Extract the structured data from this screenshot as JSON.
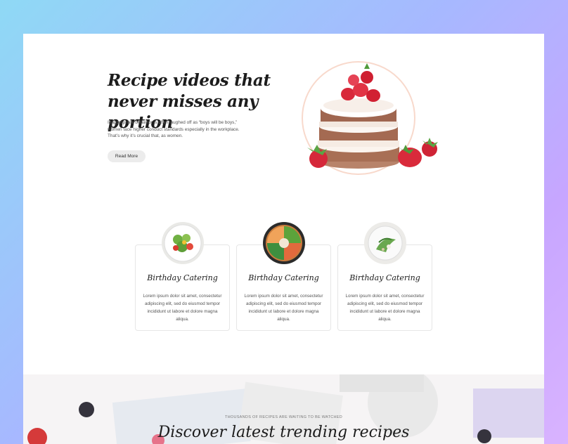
{
  "hero": {
    "title": "Recipe videos that never misses any portion",
    "description": "Inappropriate behavior is often laughed off as “boys will be boys,” women face higher conduct standards especially in the workplace. That’s why it’s crucial that, as women.",
    "button_label": "Read More",
    "image_icon": "strawberry-cake-image"
  },
  "services": [
    {
      "title": "Birthday Catering",
      "text": "Lorem ipsum dolor sit amet, consectetur adipiscing elit, sed do eiusmod tempor incididunt ut labore et dolore magna aliqua.",
      "image_icon": "salad-plate-image"
    },
    {
      "title": "Birthday Catering",
      "text": "Lorem ipsum dolor sit amet, consectetur adipiscing elit, sed do eiusmod tempor incididunt ut labore et dolore magna aliqua.",
      "image_icon": "poke-bowl-image"
    },
    {
      "title": "Birthday Catering",
      "text": "Lorem ipsum dolor sit amet, consectetur adipiscing elit, sed do eiusmod tempor incididunt ut labore et dolore magna aliqua.",
      "image_icon": "greens-plate-image"
    }
  ],
  "banner": {
    "kicker": "THOUSANDS OF RECIPES ARE WAITING TO BE WATCHED",
    "title": "Discover latest trending recipes"
  },
  "colors": {
    "background_gradient_start": "#8fd9f5",
    "background_gradient_end": "#d9b3ff",
    "card_border": "#e6e6e6",
    "button_bg": "#ececec"
  }
}
